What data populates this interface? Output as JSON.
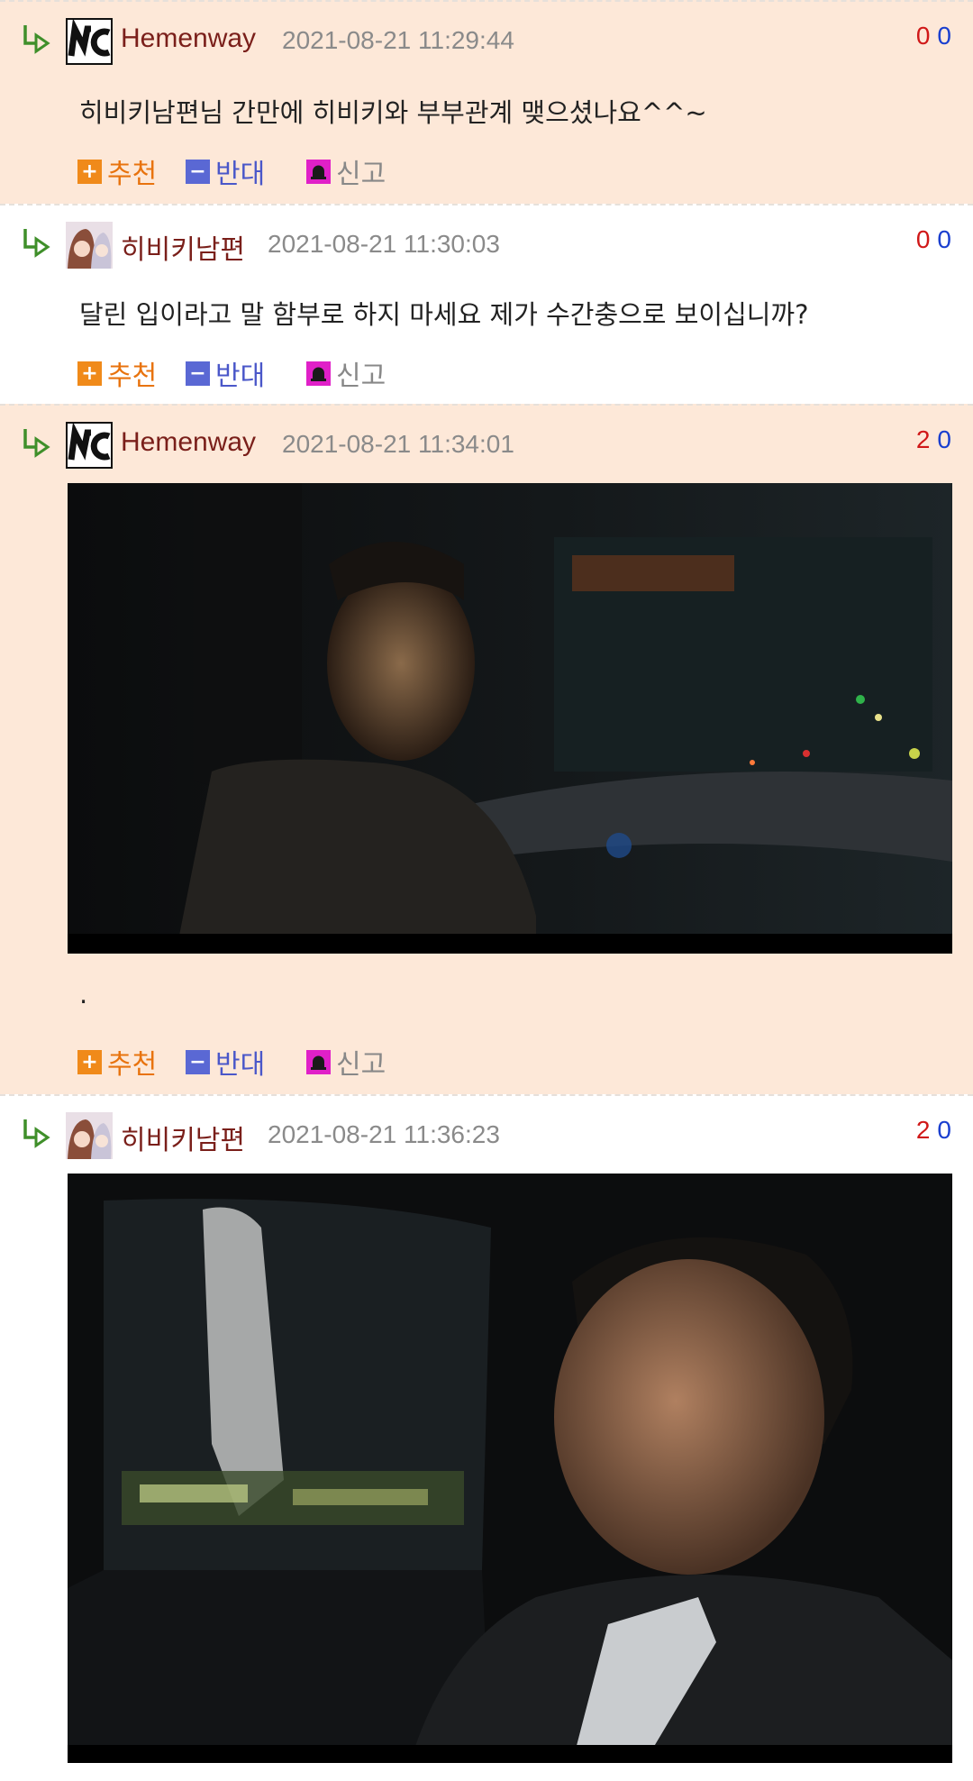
{
  "action_labels": {
    "like": "추천",
    "dislike": "반대",
    "report": "신고"
  },
  "comments": [
    {
      "author": "Hemenway",
      "date": "2021-08-21 11:29:44",
      "upvotes": "0",
      "downvotes": "0",
      "text": "히비키남편님 간만에 히비키와 부부관계 맺으셨나요^^~"
    },
    {
      "author": "히비키남편",
      "date": "2021-08-21 11:30:03",
      "upvotes": "0",
      "downvotes": "0",
      "text": "달린 입이라고 말 함부로 하지 마세요 제가 수간충으로 보이십니까?"
    },
    {
      "author": "Hemenway",
      "date": "2021-08-21 11:34:01",
      "upvotes": "2",
      "downvotes": "0",
      "text": "."
    },
    {
      "author": "히비키남편",
      "date": "2021-08-21 11:36:23",
      "upvotes": "2",
      "downvotes": "0",
      "text": ""
    }
  ],
  "colors": {
    "peach_bg": "#fde8d8",
    "author": "#7a1f1a",
    "up": "#d01818",
    "down": "#1a3fcf",
    "like": "#f08a1a",
    "dislike": "#5a68d4",
    "report": "#e020c8"
  },
  "icons": {
    "reply": "reply-arrow-icon",
    "like": "plus-icon",
    "dislike": "minus-icon",
    "report": "siren-icon"
  }
}
